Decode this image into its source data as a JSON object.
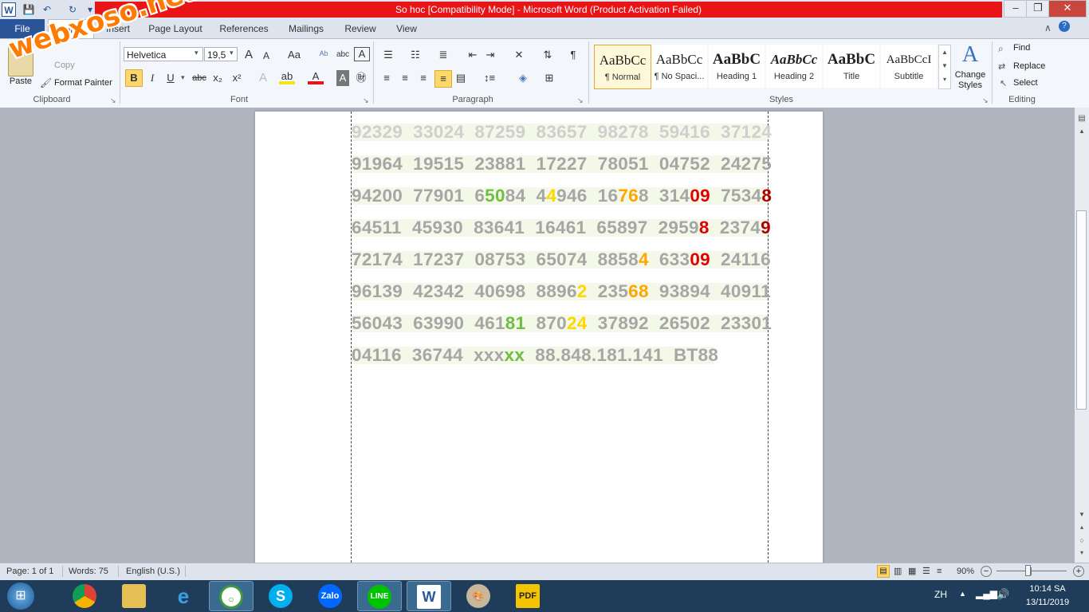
{
  "window": {
    "title": "So hoc [Compatibility Mode] -  Microsoft Word (Product Activation Failed)",
    "buttons": {
      "minimize": "–",
      "restore": "❐",
      "close": "✕"
    }
  },
  "quick_access": {
    "word_icon": "W",
    "save_icon": "💾",
    "undo_icon": "↶",
    "redo_icon": "↻",
    "customize_icon": "▾"
  },
  "tabs": {
    "file": "File",
    "items": [
      "Home",
      "Insert",
      "Page Layout",
      "References",
      "Mailings",
      "Review",
      "View"
    ]
  },
  "clipboard": {
    "paste": "Paste",
    "copy": "Copy",
    "format_painter": "Format Painter",
    "label": "Clipboard"
  },
  "font": {
    "family": "Helvetica",
    "size": "19,5",
    "grow": "A",
    "shrink": "A",
    "case": "Aa",
    "bold": "B",
    "italic": "I",
    "underline": "U",
    "strike": "abc",
    "subscript": "x₂",
    "superscript": "x²",
    "label": "Font"
  },
  "paragraph": {
    "label": "Paragraph",
    "pilcrow": "¶"
  },
  "styles": {
    "items": [
      {
        "sample": "AaBbCc",
        "name": "¶ Normal"
      },
      {
        "sample": "AaBbCc",
        "name": "¶ No Spaci..."
      },
      {
        "sample": "AaBbC",
        "name": "Heading 1"
      },
      {
        "sample": "AaBbCc",
        "name": "Heading 2"
      },
      {
        "sample": "AaBbC",
        "name": "Title"
      },
      {
        "sample": "AaBbCcI",
        "name": "Subtitle"
      }
    ],
    "change_styles": "Change Styles",
    "label": "Styles"
  },
  "editing": {
    "find": "Find",
    "replace": "Replace",
    "select": "Select",
    "label": "Editing"
  },
  "watermark": "webxoso.net",
  "document": {
    "rows": [
      "92329  33024  87259  83657  98278  59416  37124",
      "91964  19515  23881  17227  78051  04752  24275",
      "94200  77901  65084  44946  16768  31409  75348",
      "64511  45930  83641  16461  65897  29598  23749",
      "72174  17237  08753  65074  88584  63309  24116",
      "96139  42342  40698  88962  23568  93894  40911",
      "56043  63990  46181  87024  37892  26502  23301",
      "04116  36744  xxxxx  88.848.181.141  BT88"
    ]
  },
  "statusbar": {
    "page": "Page: 1 of 1",
    "words": "Words: 75",
    "language": "English (U.S.)",
    "zoom": "90%",
    "zoom_level": 0.9
  },
  "taskbar": {
    "apps": [
      "Start",
      "Chrome Beta",
      "File Explorer",
      "Internet Explorer",
      "CocCoc",
      "Skype",
      "Zalo",
      "LINE",
      "Word",
      "Paint",
      "PDF"
    ],
    "ime": "ZH",
    "time": "10:14 SA",
    "date": "13/11/2019"
  },
  "colors": {
    "file_tab": "#2a5699",
    "title_highlight": "#e81416",
    "digits": "#a6a6a6",
    "green": "#6fbe44",
    "yellow": "#ffd700",
    "orange": "#ffa500",
    "red": "#e00000"
  }
}
